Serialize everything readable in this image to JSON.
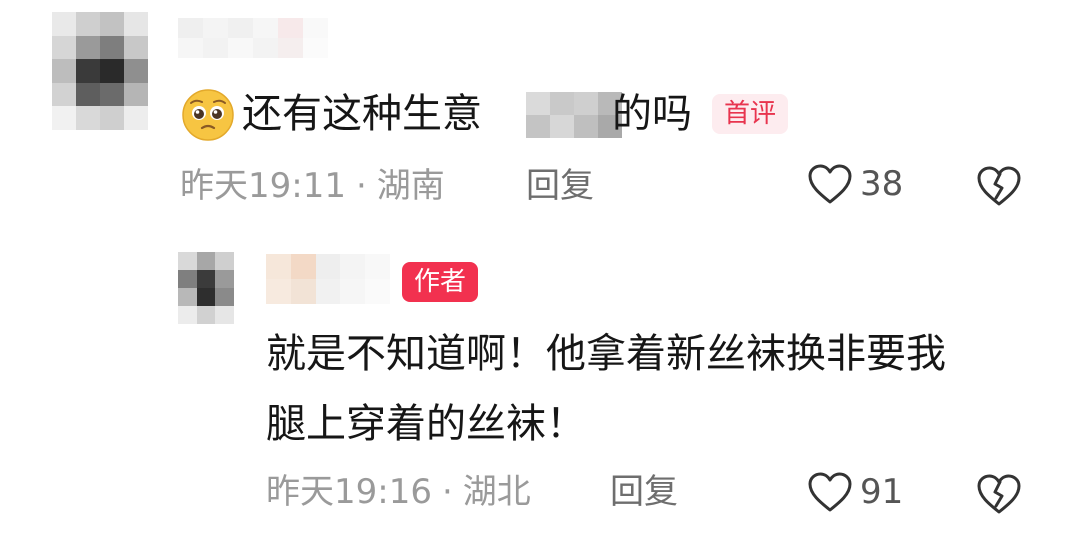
{
  "comments": [
    {
      "text_part1": "还有这种生意",
      "text_part2": "的吗",
      "badge": "首评",
      "time": "昨天19:11",
      "location": "湖南",
      "reply_label": "回复",
      "likes": "38",
      "emoji": "pleading-face-emoji",
      "reply": {
        "badge": "作者",
        "text_line1": "就是不知道啊！他拿着新丝袜换非要我",
        "text_line2": "腿上穿着的丝袜！",
        "time": "昨天19:16",
        "location": "湖北",
        "reply_label": "回复",
        "likes": "91"
      }
    }
  ],
  "meta_separator": "·",
  "icons": {
    "like": "heart-outline-icon",
    "dislike": "broken-heart-outline-icon"
  },
  "colors": {
    "badge_first_bg": "#fdecef",
    "badge_first_text": "#e8344e",
    "badge_author_bg": "#f2314f",
    "meta_text": "#9a9a9a"
  }
}
